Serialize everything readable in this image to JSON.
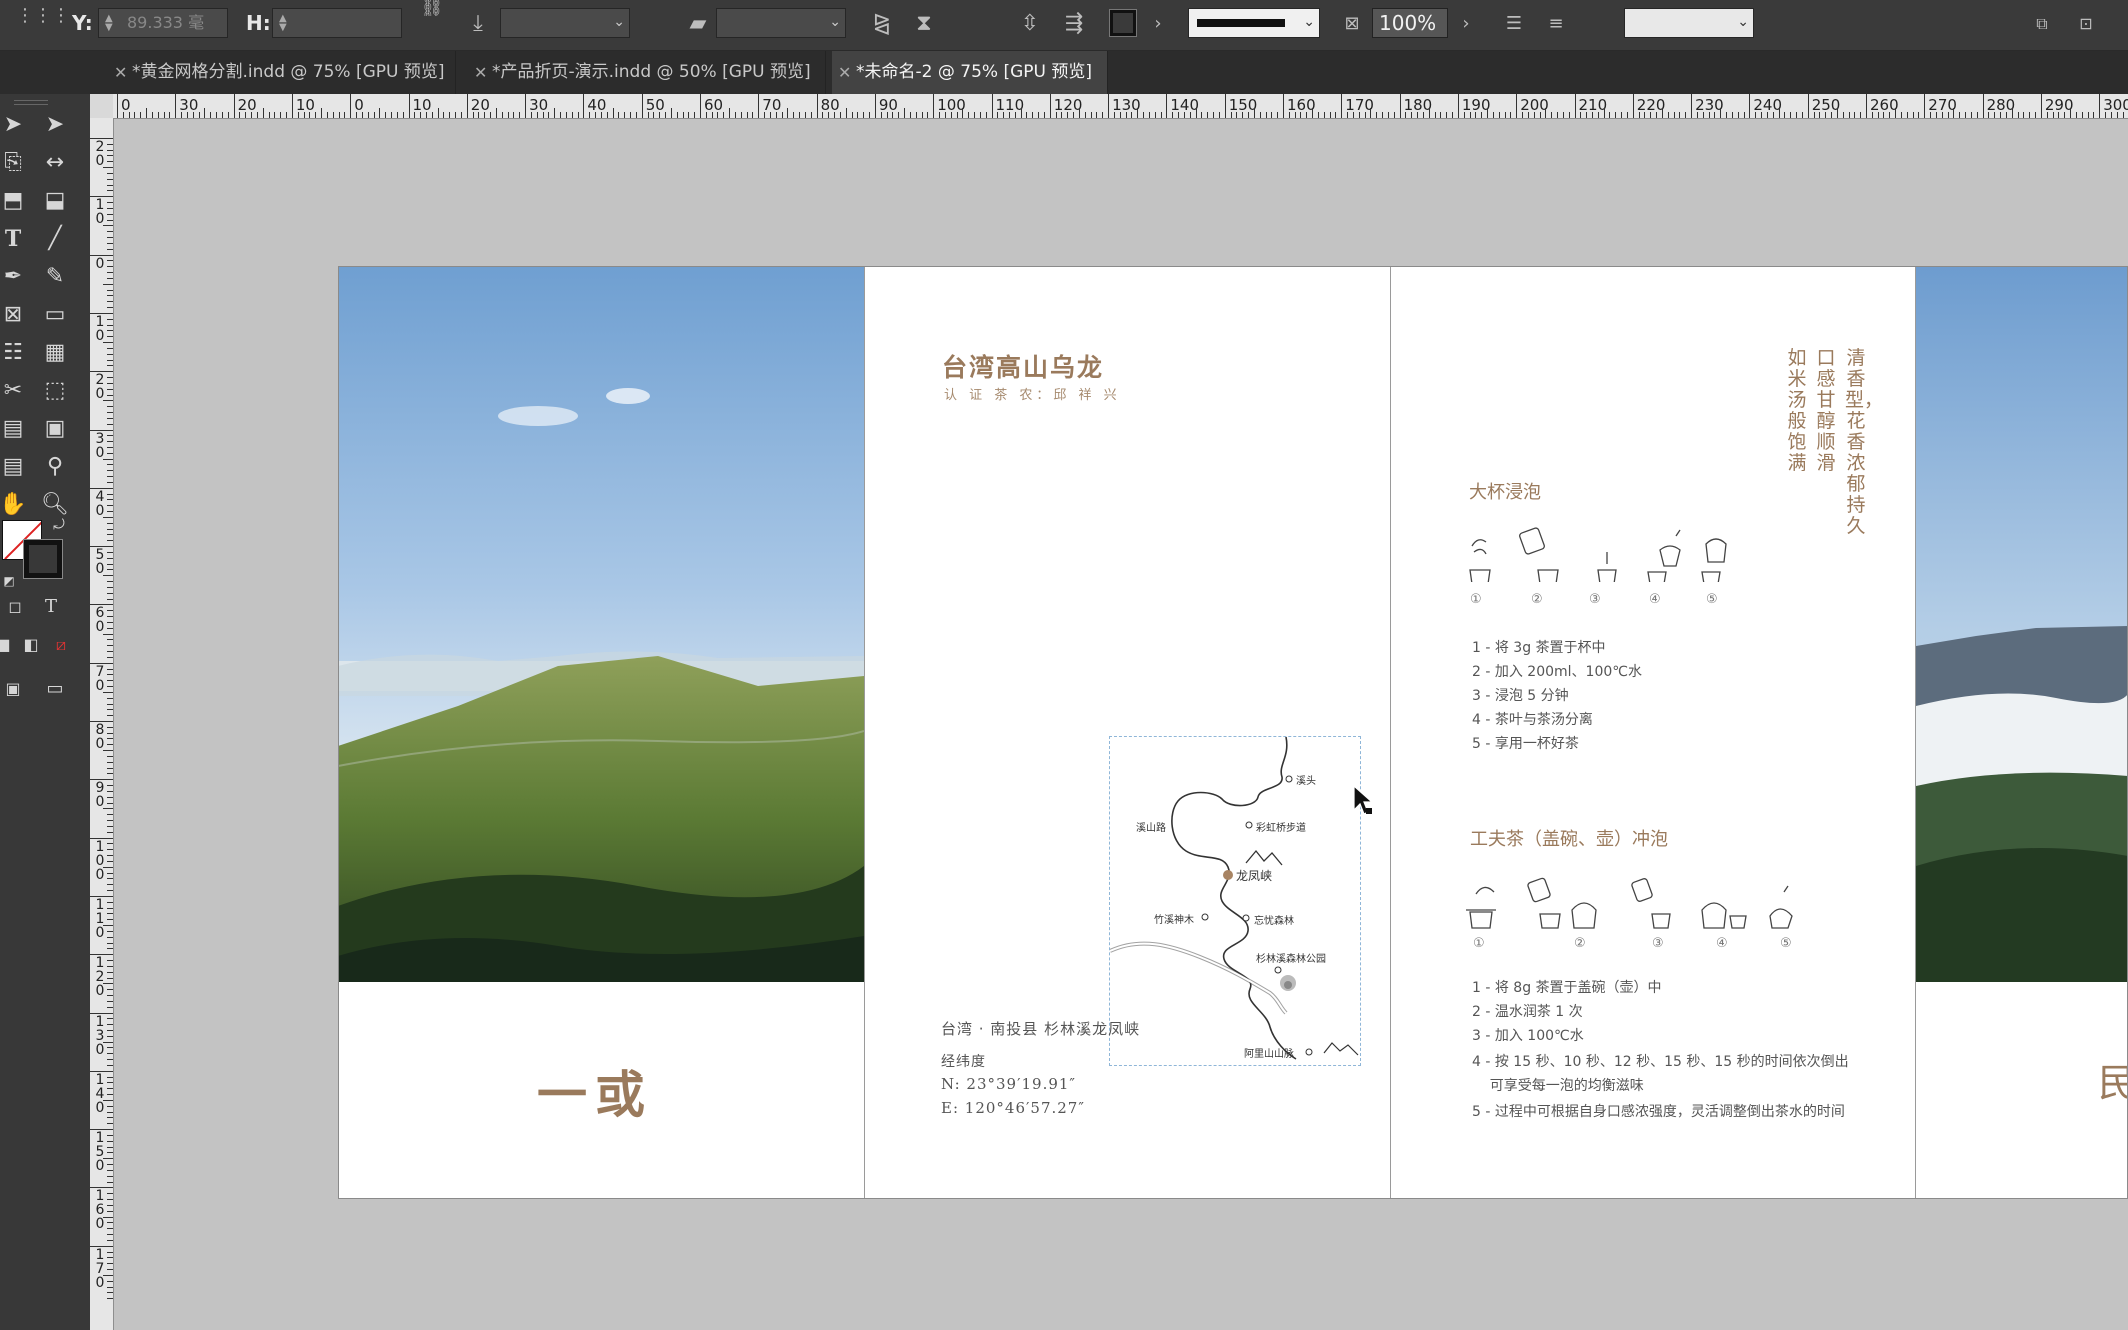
{
  "toolbar": {
    "y_label": "Y:",
    "y_value": "89.333 毫",
    "h_label": "H:",
    "h_value": "",
    "zoom_value": "100%"
  },
  "tabs": [
    {
      "label": "*黄金网格分割.indd @ 75% [GPU 预览]",
      "active": false
    },
    {
      "label": "*产品折页-演示.indd @ 50% [GPU 预览]",
      "active": false
    },
    {
      "label": "*未命名-2 @ 75% [GPU 预览]",
      "active": true
    }
  ],
  "ruler": {
    "h_ticks": [
      "0",
      "30",
      "20",
      "10",
      "0",
      "10",
      "20",
      "30",
      "40",
      "50",
      "60",
      "70",
      "80",
      "90",
      "100",
      "110",
      "120",
      "130",
      "140",
      "150",
      "160",
      "170",
      "180",
      "190",
      "200",
      "210",
      "220",
      "230",
      "240",
      "250",
      "260",
      "270",
      "280",
      "290",
      "300"
    ],
    "v_ticks": [
      "2 0",
      "1 0",
      "0",
      "1 0",
      "2 0",
      "3 0",
      "4 0",
      "5 0",
      "6 0",
      "7 0",
      "8 0",
      "9 0",
      "1 0 0",
      "1 1 0",
      "1 2 0",
      "1 3 0",
      "1 4 0",
      "1 5 0",
      "1 6 0",
      "1 7 0"
    ]
  },
  "cover": {
    "name": "一或"
  },
  "page2": {
    "title": "台湾高山乌龙",
    "subtitle": "认 证 茶 农：邱 祥 兴",
    "location": "台湾 · 南投县  杉林溪龙凤峡",
    "coord_label": "经纬度",
    "north": "N: 23°39′19.91″",
    "east": "E: 120°46′57.27″",
    "map": {
      "labels": [
        "溪头",
        "溪山路",
        "彩虹桥步道",
        "龙凤峡",
        "竹溪神木",
        "忘忧森林",
        "杉林溪森林公园",
        "阿里山山脉"
      ]
    }
  },
  "page3": {
    "vertical_text": [
      "清香型，花香浓郁持久",
      "口感甘醇顺滑",
      "如米汤般饱满"
    ],
    "section1": {
      "title": "大杯浸泡",
      "markers": [
        "①",
        "②",
        "③",
        "④",
        "⑤"
      ],
      "steps": [
        "1 - 将 3g 茶置于杯中",
        "2 - 加入 200ml、100℃水",
        "3 - 浸泡 5 分钟",
        "4 - 茶叶与茶汤分离",
        "5 - 享用一杯好茶"
      ]
    },
    "section2": {
      "title": "工夫茶（盖碗、壶）冲泡",
      "markers": [
        "①",
        "②",
        "③",
        "④",
        "⑤"
      ],
      "steps": [
        "1 - 将 8g 茶置于盖碗（壶）中",
        "2 - 温水润茶 1 次",
        "3 - 加入 100℃水",
        "4 - 按 15 秒、10 秒、12 秒、15 秒、15 秒的时间依次倒出",
        "    可享受每一泡的均衡滋味",
        "5 - 过程中可根据自身口感浓强度，灵活调整倒出茶水的时间"
      ]
    }
  },
  "page4": {
    "partial_text": "民"
  }
}
